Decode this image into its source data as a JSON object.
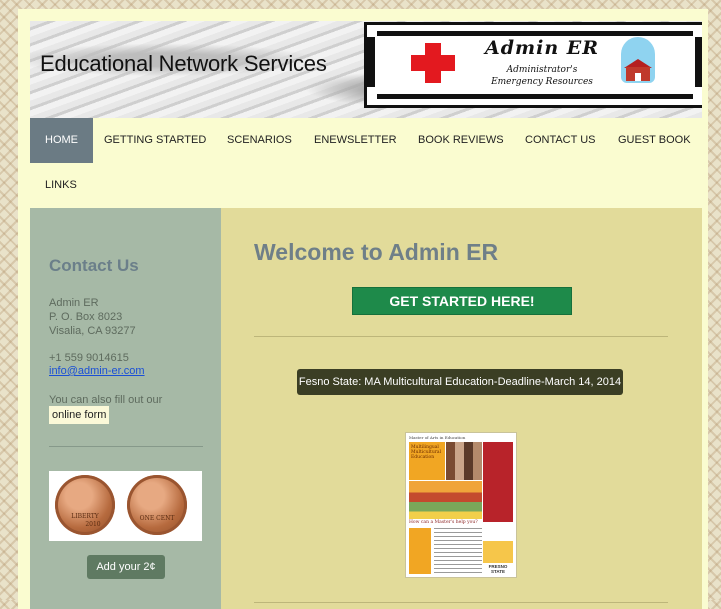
{
  "site": {
    "title": "Educational Network Services"
  },
  "logo": {
    "title": "Admin ER",
    "subtitle_line1": "Administrator's",
    "subtitle_line2": "Emergency Resources"
  },
  "nav": {
    "items": [
      {
        "label": "HOME",
        "active": true
      },
      {
        "label": "GETTING STARTED"
      },
      {
        "label": "SCENARIOS"
      },
      {
        "label": "ENEWSLETTER"
      },
      {
        "label": "BOOK REVIEWS"
      },
      {
        "label": "CONTACT US"
      },
      {
        "label": "GUEST BOOK"
      },
      {
        "label": "LINKS"
      }
    ]
  },
  "sidebar": {
    "heading": "Contact Us",
    "address": [
      "Admin ER",
      "P. O. Box 8023",
      "Visalia, CA 93277"
    ],
    "phone": "+1 559 9014615",
    "email": "info@admin-er.com",
    "form_intro": "You can also fill out our",
    "form_link": "online form",
    "penny_text": [
      "LIBERTY",
      "2010",
      "ONE CENT"
    ],
    "add_button": "Add your 2¢"
  },
  "main": {
    "welcome": "Welcome to Admin ER",
    "get_started": "GET STARTED HERE!",
    "fresno_button": "Fesno State: MA Multicultural Education-Deadline-March 14, 2014",
    "flyer": {
      "header": "Master of Arts in Education",
      "title": "Multilingual Multicultural Education",
      "question": "How can a Master's help you?",
      "logo": "FRESNO STATE"
    }
  },
  "colors": {
    "nav_active": "#6b7b84",
    "sidebar_bg": "#a6b9a6",
    "main_bg": "#e2db9a",
    "get_started_bg": "#1e8a4a",
    "fresno_btn_bg": "#3b3e24",
    "cross_red": "#e3191f"
  }
}
